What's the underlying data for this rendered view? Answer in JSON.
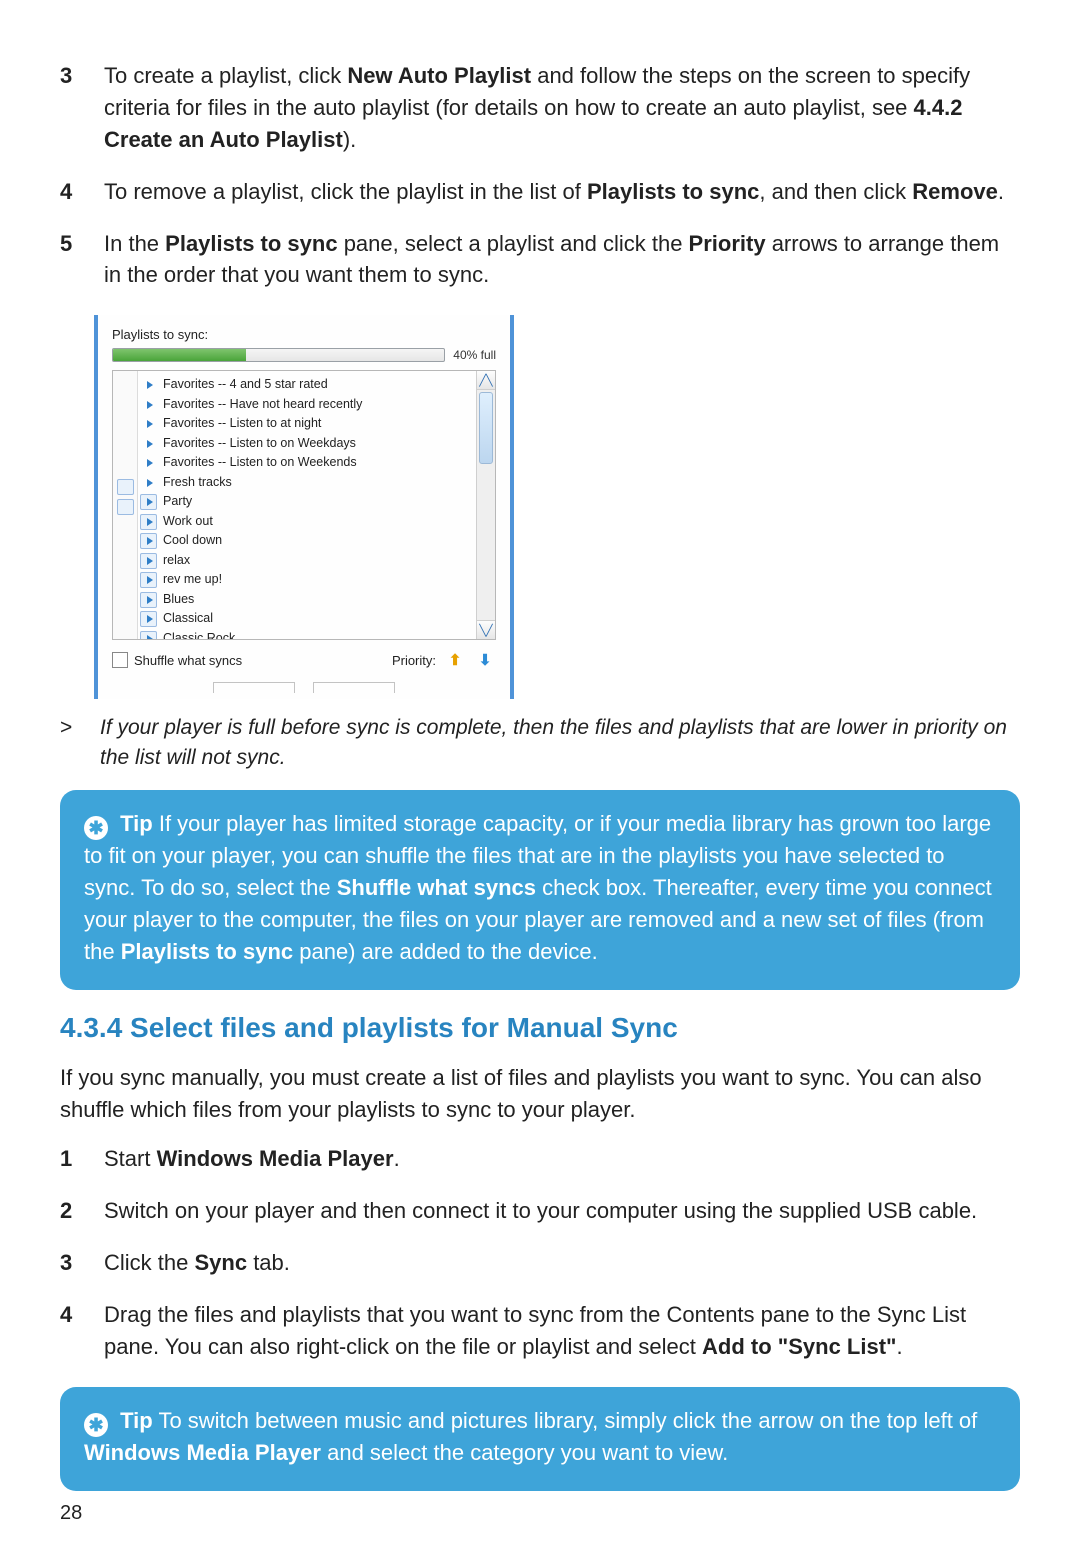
{
  "steps_a": [
    {
      "num": "3",
      "html": "To create a playlist, click <b>New Auto Playlist</b> and follow the steps on the screen to specify criteria for files in the auto playlist (for details on how to create an auto playlist, see <b>4.4.2 Create an Auto Playlist</b>)."
    },
    {
      "num": "4",
      "html": "To remove a playlist, click the playlist in the list of <b>Playlists to sync</b>, and then click <b>Remove</b>."
    },
    {
      "num": "5",
      "html": "In the <b>Playlists to sync</b> pane, select a playlist and click the <b>Priority</b> arrows to arrange them in the order that you want them to sync."
    }
  ],
  "shot": {
    "title": "Playlists to sync:",
    "capacity_pct": 40,
    "capacity_label": "40% full",
    "playlists": [
      {
        "label": "Favorites -- 4 and 5 star rated",
        "boxed": false
      },
      {
        "label": "Favorites -- Have not heard recently",
        "boxed": false
      },
      {
        "label": "Favorites -- Listen to at night",
        "boxed": false
      },
      {
        "label": "Favorites -- Listen to on Weekdays",
        "boxed": false
      },
      {
        "label": "Favorites -- Listen to on Weekends",
        "boxed": false
      },
      {
        "label": "Fresh tracks",
        "boxed": false
      },
      {
        "label": "Party",
        "boxed": true
      },
      {
        "label": "Work out",
        "boxed": true
      },
      {
        "label": "Cool down",
        "boxed": true
      },
      {
        "label": "relax",
        "boxed": true
      },
      {
        "label": "rev me up!",
        "boxed": true
      },
      {
        "label": "Blues",
        "boxed": true
      },
      {
        "label": "Classical",
        "boxed": true
      },
      {
        "label": "Classic Rock",
        "boxed": true
      }
    ],
    "shuffle_label": "Shuffle what syncs",
    "priority_label": "Priority:"
  },
  "note_symbol": ">",
  "note_text": "If your player is full before sync is complete, then the files and playlists that are lower in priority on the list will not sync.",
  "tip1": {
    "label": "Tip",
    "html": "If your player has limited storage capacity, or if your media library has grown too large to fit on your player, you can shuffle the files that are in the playlists you have selected to sync. To do so, select the <b>Shuffle what syncs</b> check box. Thereafter, every time you connect your player to the computer, the files on your player are removed and a new set of files (from the <b>Playlists to sync</b> pane) are added to the device."
  },
  "section_heading": "4.3.4 Select files and playlists for Manual Sync",
  "section_intro": "If you sync manually, you must create a list of files and playlists you want to sync. You can also shuffle which files from your playlists to sync to your player.",
  "steps_b": [
    {
      "num": "1",
      "html": "Start <b>Windows Media Player</b>."
    },
    {
      "num": "2",
      "html": "Switch on your player and then connect it to your computer using the supplied USB cable."
    },
    {
      "num": "3",
      "html": "Click the <b>Sync</b> tab."
    },
    {
      "num": "4",
      "html": "Drag the files and playlists that you want to sync from the Contents pane to the Sync List pane. You can also right-click on the file or playlist and select <b>Add to \"Sync List\"</b>."
    }
  ],
  "tip2": {
    "label": "Tip",
    "html": "To switch between music and pictures library, simply click the arrow on the top left of <b>Windows Media Player</b> and select the category you want to view."
  },
  "page_number": "28"
}
